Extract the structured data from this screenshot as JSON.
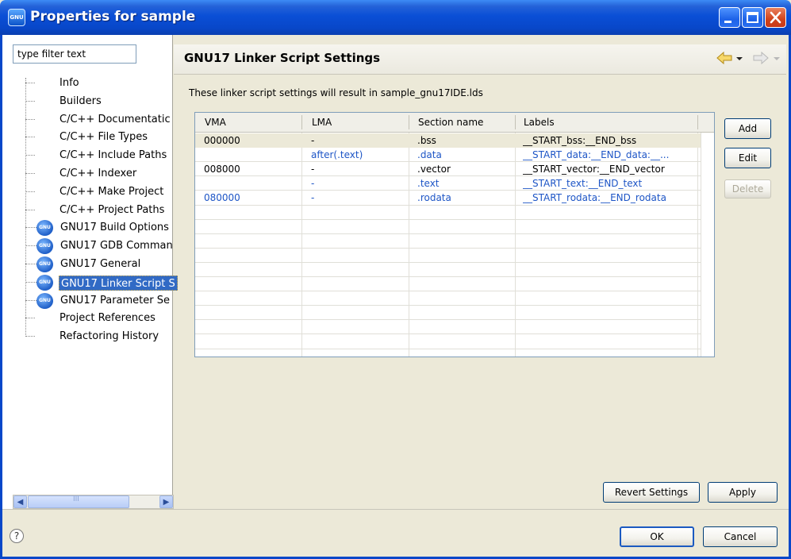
{
  "window": {
    "title": "Properties for sample",
    "icon_label": "GNU"
  },
  "filter": {
    "value": "type filter text"
  },
  "tree": {
    "items": [
      {
        "label": "Info",
        "icon": "none"
      },
      {
        "label": "Builders",
        "icon": "none"
      },
      {
        "label": "C/C++ Documentatic",
        "icon": "none"
      },
      {
        "label": "C/C++ File Types",
        "icon": "none"
      },
      {
        "label": "C/C++ Include Paths",
        "icon": "none"
      },
      {
        "label": "C/C++ Indexer",
        "icon": "none"
      },
      {
        "label": "C/C++ Make Project",
        "icon": "none"
      },
      {
        "label": "C/C++ Project Paths",
        "icon": "none"
      },
      {
        "label": "GNU17 Build Options",
        "icon": "gnu-icon"
      },
      {
        "label": "GNU17 GDB Comman",
        "icon": "gnu-icon"
      },
      {
        "label": "GNU17 General",
        "icon": "gnu-icon"
      },
      {
        "label": "GNU17 Linker Script S",
        "icon": "gnu-icon",
        "selected": true
      },
      {
        "label": "GNU17 Parameter Se",
        "icon": "gnu-icon"
      },
      {
        "label": "Project References",
        "icon": "none"
      },
      {
        "label": "Refactoring History",
        "icon": "none"
      }
    ],
    "scroll_thumb_glyph": "III"
  },
  "page": {
    "title": "GNU17 Linker Script Settings",
    "description": "These linker script settings will result in sample_gnu17IDE.lds"
  },
  "table": {
    "columns": [
      "VMA",
      "LMA",
      "Section name",
      "Labels"
    ],
    "rows": [
      {
        "vma": "000000",
        "lma": "-",
        "section": ".bss",
        "labels": "__START_bss:__END_bss",
        "color": "black",
        "selected": true
      },
      {
        "vma": "",
        "lma": "after(.text)",
        "section": ".data",
        "labels": "__START_data:__END_data:__...",
        "color": "blue"
      },
      {
        "vma": "008000",
        "lma": "-",
        "section": ".vector",
        "labels": "__START_vector:__END_vector",
        "color": "black"
      },
      {
        "vma": "",
        "lma": "-",
        "section": ".text",
        "labels": "__START_text:__END_text",
        "color": "blue"
      },
      {
        "vma": "080000",
        "lma": "-",
        "section": ".rodata",
        "labels": "__START_rodata:__END_rodata",
        "color": "blue"
      }
    ]
  },
  "buttons": {
    "add": "Add",
    "edit": "Edit",
    "delete": "Delete",
    "revert": "Revert Settings",
    "apply": "Apply",
    "ok": "OK",
    "cancel": "Cancel"
  },
  "help": {
    "glyph": "?"
  },
  "colors": {
    "titlebar": "#0a4fd6",
    "selection": "#316ac5",
    "link_blue": "#1d55c6",
    "dialog_bg": "#ece9d8"
  }
}
